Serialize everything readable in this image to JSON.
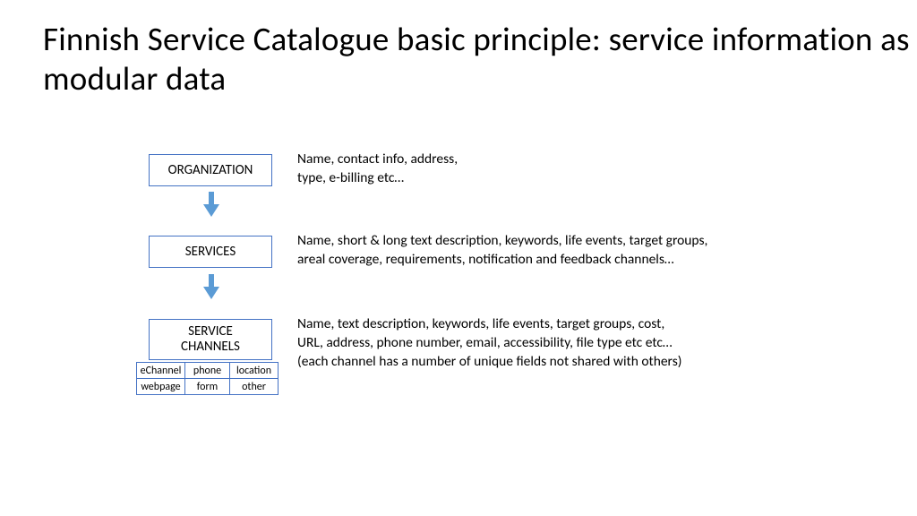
{
  "title": "Finnish Service Catalogue basic principle: service information as modular data",
  "rows": [
    {
      "label": "ORGANIZATION",
      "desc": "Name, contact info, address,\ntype, e-billing etc…"
    },
    {
      "label": "SERVICES",
      "desc": "Name, short & long text description, keywords, life events, target groups,\nareal coverage, requirements, notification and feedback channels…"
    },
    {
      "label": "SERVICE\nCHANNELS",
      "desc": "Name, text description, keywords, life events, target groups, cost,\nURL, address, phone number, email, accessibility, file type etc etc…\n(each channel has a number of unique fields not shared with others)"
    }
  ],
  "grid": [
    [
      "eChannel",
      "phone",
      "location"
    ],
    [
      "webpage",
      "form",
      "other"
    ]
  ]
}
